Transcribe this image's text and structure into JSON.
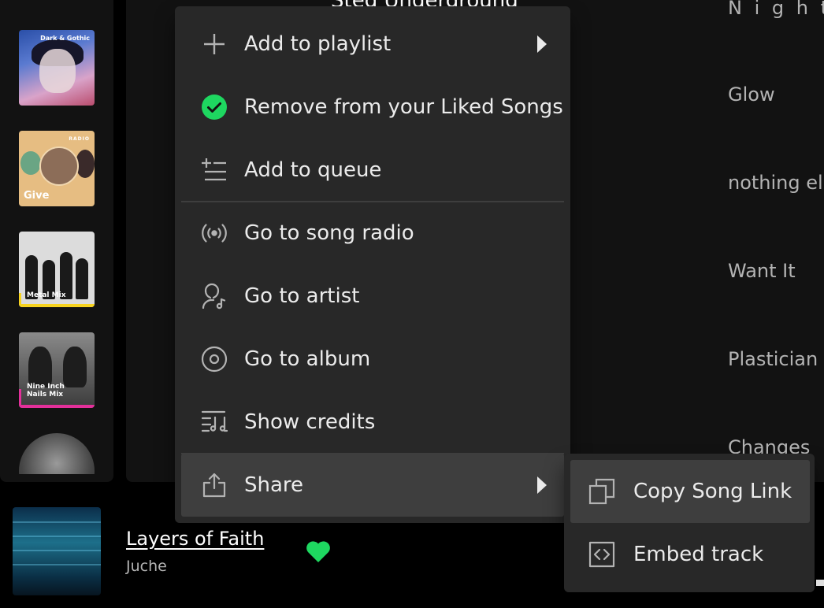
{
  "sidebar": {
    "tiles": [
      {
        "name": "playlist-dark-gothic",
        "label": "Dark & Gothic"
      },
      {
        "name": "playlist-give-radio",
        "badge": "RADIO",
        "label": "Give"
      },
      {
        "name": "playlist-metal-mix",
        "label": "Metal Mix"
      },
      {
        "name": "playlist-nine-inch-nails-mix",
        "label": "Nine Inch Nails Mix"
      }
    ]
  },
  "background": {
    "partial_header": "Sted Underground",
    "right_column": [
      "N i g h t D",
      "Glow",
      "nothing el",
      "Want It",
      "Plastician",
      "Changes"
    ]
  },
  "context_menu": {
    "items": [
      {
        "label": "Add to playlist",
        "icon": "plus-icon",
        "has_submenu": true
      },
      {
        "label": "Remove from your Liked Songs",
        "icon": "check-circle-icon"
      },
      {
        "label": "Add to queue",
        "icon": "add-queue-icon"
      },
      {
        "label": "Go to song radio",
        "icon": "radio-icon"
      },
      {
        "label": "Go to artist",
        "icon": "artist-icon"
      },
      {
        "label": "Go to album",
        "icon": "album-icon"
      },
      {
        "label": "Show credits",
        "icon": "credits-icon"
      },
      {
        "label": "Share",
        "icon": "share-icon",
        "has_submenu": true,
        "highlighted": true
      }
    ]
  },
  "share_submenu": {
    "items": [
      {
        "label": "Copy Song Link",
        "icon": "copy-icon",
        "highlighted": true
      },
      {
        "label": "Embed track",
        "icon": "embed-icon"
      }
    ]
  },
  "now_playing": {
    "title": "Layers of Faith",
    "artist": "Juche",
    "liked": true
  },
  "colors": {
    "accent_green": "#1ed760",
    "menu_bg": "#282828",
    "menu_hover": "#3e3e3e"
  }
}
